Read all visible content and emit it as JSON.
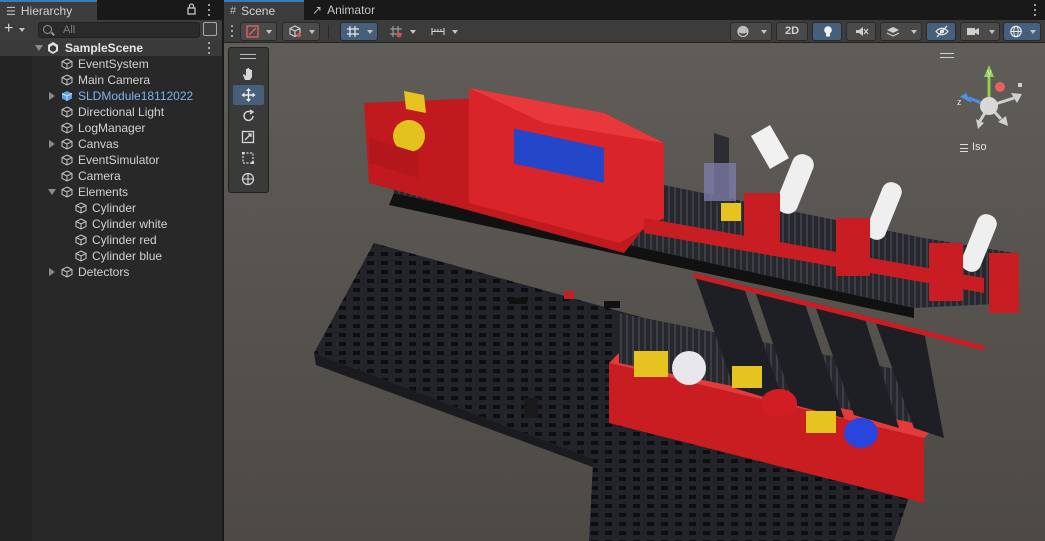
{
  "hierarchy": {
    "tab_label": "Hierarchy",
    "search_placeholder": "All",
    "scene_name": "SampleScene",
    "items": [
      {
        "label": "EventSystem"
      },
      {
        "label": "Main Camera"
      },
      {
        "label": "SLDModule18112022"
      },
      {
        "label": "Directional Light"
      },
      {
        "label": "LogManager"
      },
      {
        "label": "Canvas"
      },
      {
        "label": "EventSimulator"
      },
      {
        "label": "Camera"
      },
      {
        "label": "Elements"
      },
      {
        "label": "Cylinder"
      },
      {
        "label": "Cylinder white"
      },
      {
        "label": "Cylinder red"
      },
      {
        "label": "Cylinder blue"
      },
      {
        "label": "Detectors"
      }
    ]
  },
  "scene": {
    "tabs": [
      {
        "label": "Scene"
      },
      {
        "label": "Animator"
      }
    ],
    "toolbar": {
      "mode_2d_label": "2D"
    },
    "gizmo": {
      "projection_label": "Iso",
      "axis_y": "y",
      "axis_z": "z"
    }
  },
  "icons": {
    "hierarchy_tab": "list-icon",
    "scene_tab": "grid-icon",
    "animator_tab": "animator-icon",
    "game_object": "cube-outline-icon",
    "prefab": "prefab-cube-icon"
  },
  "colors": {
    "accent_tab": "#3a79bb",
    "prefab_text": "#7cb4f0",
    "active_button": "#46607c",
    "model_red": "#d01f24",
    "model_yellow": "#e8c21f",
    "model_blue": "#2b46d6"
  }
}
